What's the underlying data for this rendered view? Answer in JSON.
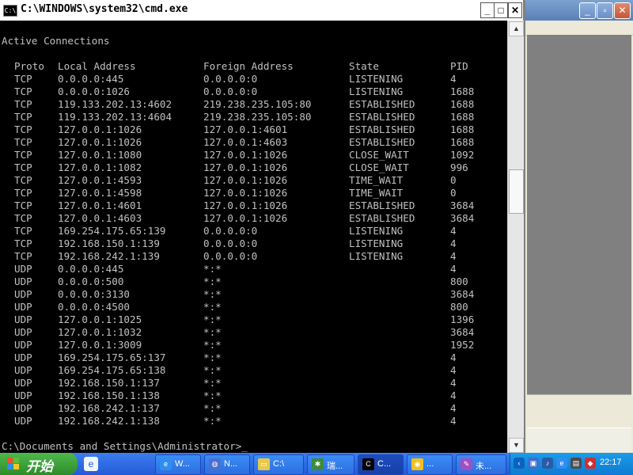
{
  "window": {
    "title": "C:\\WINDOWS\\system32\\cmd.exe",
    "icon_text": "C:\\",
    "controls": {
      "minimize": "_",
      "maximize": "□",
      "close": "✕"
    }
  },
  "console": {
    "heading": "Active Connections",
    "columns": [
      "Proto",
      "Local Address",
      "Foreign Address",
      "State",
      "PID"
    ],
    "rows": [
      [
        "TCP",
        "0.0.0.0:445",
        "0.0.0.0:0",
        "LISTENING",
        "4"
      ],
      [
        "TCP",
        "0.0.0.0:1026",
        "0.0.0.0:0",
        "LISTENING",
        "1688"
      ],
      [
        "TCP",
        "119.133.202.13:4602",
        "219.238.235.105:80",
        "ESTABLISHED",
        "1688"
      ],
      [
        "TCP",
        "119.133.202.13:4604",
        "219.238.235.105:80",
        "ESTABLISHED",
        "1688"
      ],
      [
        "TCP",
        "127.0.0.1:1026",
        "127.0.0.1:4601",
        "ESTABLISHED",
        "1688"
      ],
      [
        "TCP",
        "127.0.0.1:1026",
        "127.0.0.1:4603",
        "ESTABLISHED",
        "1688"
      ],
      [
        "TCP",
        "127.0.0.1:1080",
        "127.0.0.1:1026",
        "CLOSE_WAIT",
        "1092"
      ],
      [
        "TCP",
        "127.0.0.1:1082",
        "127.0.0.1:1026",
        "CLOSE_WAIT",
        "996"
      ],
      [
        "TCP",
        "127.0.0.1:4593",
        "127.0.0.1:1026",
        "TIME_WAIT",
        "0"
      ],
      [
        "TCP",
        "127.0.0.1:4598",
        "127.0.0.1:1026",
        "TIME_WAIT",
        "0"
      ],
      [
        "TCP",
        "127.0.0.1:4601",
        "127.0.0.1:1026",
        "ESTABLISHED",
        "3684"
      ],
      [
        "TCP",
        "127.0.0.1:4603",
        "127.0.0.1:1026",
        "ESTABLISHED",
        "3684"
      ],
      [
        "TCP",
        "169.254.175.65:139",
        "0.0.0.0:0",
        "LISTENING",
        "4"
      ],
      [
        "TCP",
        "192.168.150.1:139",
        "0.0.0.0:0",
        "LISTENING",
        "4"
      ],
      [
        "TCP",
        "192.168.242.1:139",
        "0.0.0.0:0",
        "LISTENING",
        "4"
      ],
      [
        "UDP",
        "0.0.0.0:445",
        "*:*",
        "",
        "4"
      ],
      [
        "UDP",
        "0.0.0.0:500",
        "*:*",
        "",
        "800"
      ],
      [
        "UDP",
        "0.0.0.0:3130",
        "*:*",
        "",
        "3684"
      ],
      [
        "UDP",
        "0.0.0.0:4500",
        "*:*",
        "",
        "800"
      ],
      [
        "UDP",
        "127.0.0.1:1025",
        "*:*",
        "",
        "1396"
      ],
      [
        "UDP",
        "127.0.0.1:1032",
        "*:*",
        "",
        "3684"
      ],
      [
        "UDP",
        "127.0.0.1:3009",
        "*:*",
        "",
        "1952"
      ],
      [
        "UDP",
        "169.254.175.65:137",
        "*:*",
        "",
        "4"
      ],
      [
        "UDP",
        "169.254.175.65:138",
        "*:*",
        "",
        "4"
      ],
      [
        "UDP",
        "192.168.150.1:137",
        "*:*",
        "",
        "4"
      ],
      [
        "UDP",
        "192.168.150.1:138",
        "*:*",
        "",
        "4"
      ],
      [
        "UDP",
        "192.168.242.1:137",
        "*:*",
        "",
        "4"
      ],
      [
        "UDP",
        "192.168.242.1:138",
        "*:*",
        "",
        "4"
      ]
    ],
    "prompt": "C:\\Documents and Settings\\Administrator>_"
  },
  "taskbar": {
    "start_label": "开始",
    "quick_launch_icon": "ie-icon",
    "tasks": [
      {
        "label": "W...",
        "icon": "ie-icon",
        "active": false
      },
      {
        "label": "N...",
        "icon": "network-icon",
        "active": false
      },
      {
        "label": "C:\\",
        "icon": "folder-icon",
        "active": false
      },
      {
        "label": "瑞...",
        "icon": "app-icon",
        "active": false
      },
      {
        "label": "C...",
        "icon": "cmd-icon",
        "active": true
      },
      {
        "label": "...",
        "icon": "qq-icon",
        "active": false
      },
      {
        "label": "未...",
        "icon": "paint-icon",
        "active": false
      }
    ],
    "tray_icons": [
      "expand-icon",
      "network-icon",
      "sound-icon",
      "ie-icon",
      "app-icon",
      "shield-icon"
    ],
    "clock": "22:17"
  },
  "colors": {
    "console_bg": "#000000",
    "console_text": "#c0c0c0",
    "taskbar": "#245ad8",
    "start_button": "#3a9e37"
  }
}
